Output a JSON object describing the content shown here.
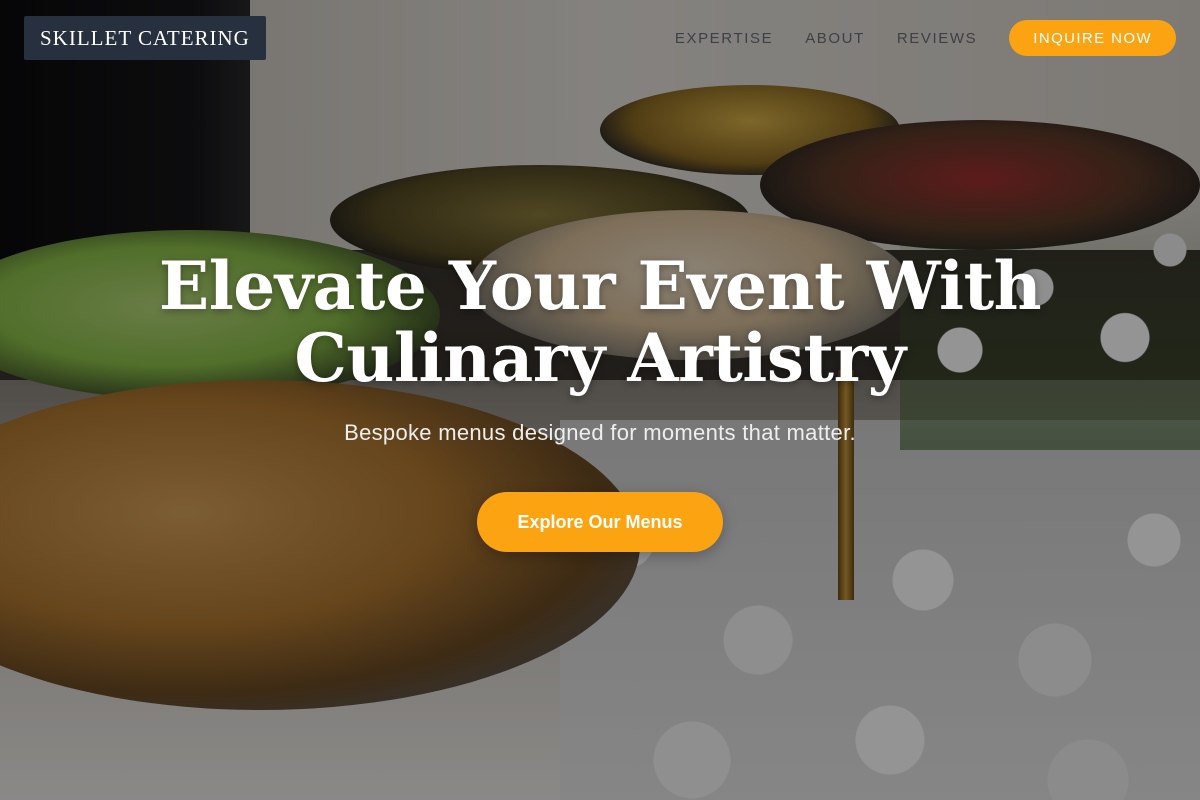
{
  "header": {
    "brand": "SKILLET CATERING",
    "nav": [
      {
        "label": "EXPERTISE"
      },
      {
        "label": "ABOUT"
      },
      {
        "label": "REVIEWS"
      }
    ],
    "cta_label": "INQUIRE NOW"
  },
  "hero": {
    "title_line1": "Elevate Your Event With",
    "title_line2": "Culinary Artistry",
    "subtitle": "Bespoke menus designed for moments that matter.",
    "cta_label": "Explore Our Menus",
    "background": "catering-buffet-photo"
  },
  "colors": {
    "accent": "#fca311",
    "logo_bg": "#27303f",
    "nav_text": "#3d4046"
  }
}
